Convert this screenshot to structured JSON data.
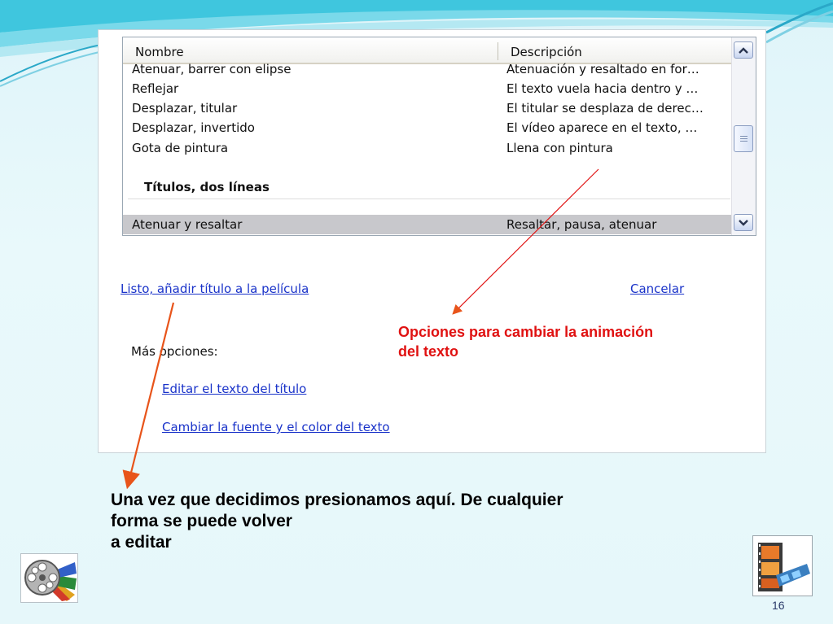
{
  "list": {
    "columns": [
      "Nombre",
      "Descripción"
    ],
    "rows": [
      {
        "name": "Atenuar, barrer con elipse",
        "desc": "Atenuación y resaltado en for…"
      },
      {
        "name": "Reflejar",
        "desc": "El texto vuela hacia dentro y …"
      },
      {
        "name": "Desplazar, titular",
        "desc": "El titular se desplaza de derec…"
      },
      {
        "name": "Desplazar, invertido",
        "desc": "El vídeo aparece en el texto, …"
      },
      {
        "name": "Gota de pintura",
        "desc": "Llena con pintura"
      }
    ],
    "group_title": "Títulos, dos líneas",
    "selected_row": {
      "name": "Atenuar y resaltar",
      "desc": "Resaltar, pausa, atenuar"
    }
  },
  "actions": {
    "done_link": "Listo, añadir título a la película",
    "cancel_link": "Cancelar",
    "more_options_label": "Más opciones:",
    "edit_title_link": "Editar el texto del título",
    "change_font_link": "Cambiar la fuente y el color del texto"
  },
  "annotations": {
    "options_note": "Opciones para cambiar la animación del texto",
    "caption_lines": [
      "Una vez que decidimos presionamos aquí. De cualquier",
      "forma se puede volver",
      "a editar"
    ]
  },
  "slide": {
    "page_number": "16"
  },
  "colors": {
    "link": "#1a33c9",
    "annotation": "#e01212",
    "selection": "#c8c8cc"
  }
}
